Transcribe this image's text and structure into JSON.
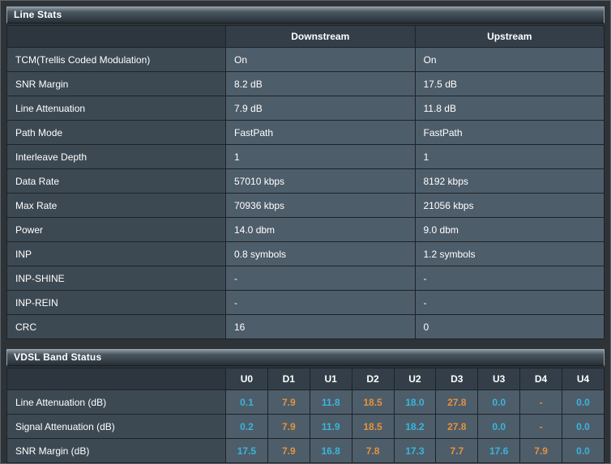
{
  "line_stats": {
    "title": "Line Stats",
    "columns": [
      "Downstream",
      "Upstream"
    ],
    "rows": [
      {
        "label": "TCM(Trellis Coded Modulation)",
        "values": [
          "On",
          "On"
        ]
      },
      {
        "label": "SNR Margin",
        "values": [
          "8.2 dB",
          "17.5 dB"
        ]
      },
      {
        "label": "Line Attenuation",
        "values": [
          "7.9 dB",
          "11.8 dB"
        ]
      },
      {
        "label": "Path Mode",
        "values": [
          "FastPath",
          "FastPath"
        ]
      },
      {
        "label": "Interleave Depth",
        "values": [
          "1",
          "1"
        ]
      },
      {
        "label": "Data Rate",
        "values": [
          "57010 kbps",
          "8192 kbps"
        ]
      },
      {
        "label": "Max Rate",
        "values": [
          "70936 kbps",
          "21056 kbps"
        ]
      },
      {
        "label": "Power",
        "values": [
          "14.0 dbm",
          "9.0 dbm"
        ]
      },
      {
        "label": "INP",
        "values": [
          "0.8 symbols",
          "1.2 symbols"
        ]
      },
      {
        "label": "INP-SHINE",
        "values": [
          "-",
          "-"
        ]
      },
      {
        "label": "INP-REIN",
        "values": [
          "-",
          "-"
        ]
      },
      {
        "label": "CRC",
        "values": [
          "16",
          "0"
        ]
      }
    ]
  },
  "vdsl_band_status": {
    "title": "VDSL Band Status",
    "columns": [
      "U0",
      "D1",
      "U1",
      "D2",
      "U2",
      "D3",
      "U3",
      "D4",
      "U4"
    ],
    "rows": [
      {
        "label": "Line Attenuation (dB)",
        "values": [
          "0.1",
          "7.9",
          "11.8",
          "18.5",
          "18.0",
          "27.8",
          "0.0",
          "-",
          "0.0"
        ]
      },
      {
        "label": "Signal Attenuation (dB)",
        "values": [
          "0.2",
          "7.9",
          "11.9",
          "18.5",
          "18.2",
          "27.8",
          "0.0",
          "-",
          "0.0"
        ]
      },
      {
        "label": "SNR Margin (dB)",
        "values": [
          "17.5",
          "7.9",
          "16.8",
          "7.8",
          "17.3",
          "7.7",
          "17.6",
          "7.9",
          "0.0"
        ]
      }
    ]
  },
  "colors": {
    "upstream_value": "#38b6dc",
    "downstream_value": "#e6923c"
  }
}
